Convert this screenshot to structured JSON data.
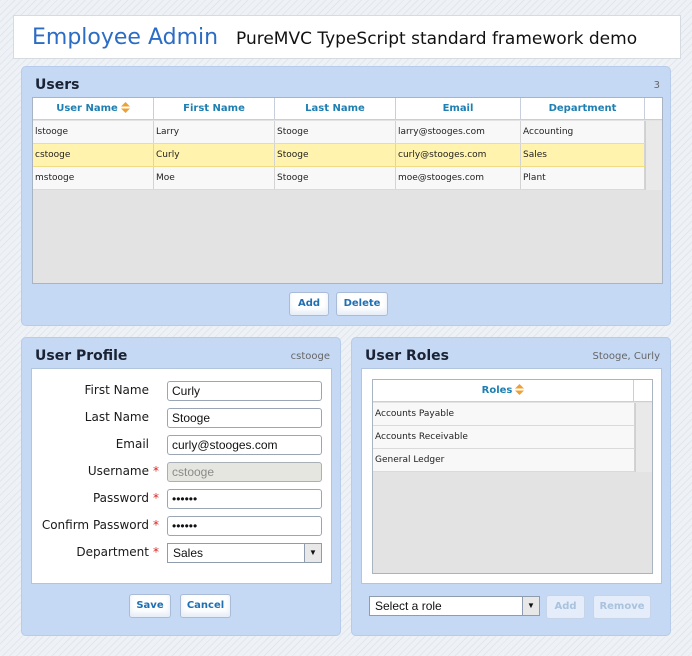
{
  "header": {
    "title": "Employee Admin",
    "subtitle": "PureMVC TypeScript standard framework demo"
  },
  "users_panel": {
    "title": "Users",
    "count": "3",
    "columns": [
      "User Name",
      "First Name",
      "Last Name",
      "Email",
      "Department"
    ],
    "rows": [
      {
        "username": "lstooge",
        "first": "Larry",
        "last": "Stooge",
        "email": "larry@stooges.com",
        "department": "Accounting"
      },
      {
        "username": "cstooge",
        "first": "Curly",
        "last": "Stooge",
        "email": "curly@stooges.com",
        "department": "Sales"
      },
      {
        "username": "mstooge",
        "first": "Moe",
        "last": "Stooge",
        "email": "moe@stooges.com",
        "department": "Plant"
      }
    ],
    "selected_row": 1,
    "add_label": "Add",
    "delete_label": "Delete"
  },
  "profile_panel": {
    "title": "User Profile",
    "status": "cstooge",
    "labels": {
      "first_name": "First Name",
      "last_name": "Last Name",
      "email": "Email",
      "username": "Username",
      "password": "Password",
      "confirm_password": "Confirm Password",
      "department": "Department"
    },
    "required_mark": "*",
    "values": {
      "first_name": "Curly",
      "last_name": "Stooge",
      "email": "curly@stooges.com",
      "username": "cstooge",
      "password": "••••••",
      "confirm_password": "••••••",
      "department": "Sales"
    },
    "save_label": "Save",
    "cancel_label": "Cancel"
  },
  "roles_panel": {
    "title": "User Roles",
    "status": "Stooge, Curly",
    "column": "Roles",
    "rows": [
      "Accounts Payable",
      "Accounts Receivable",
      "General Ledger"
    ],
    "role_select": "Select a role",
    "add_label": "Add",
    "remove_label": "Remove"
  },
  "colors": {
    "brand": "#2b6cc4",
    "panel_bg": "#c5d9f5",
    "header_text": "#1e7fb2",
    "selected_row": "#fff3ad",
    "sort_arrow": "#f0a030",
    "required": "#dd2222"
  },
  "icons": {
    "sort": "sort-arrows-icon",
    "dropdown": "chevron-down-icon"
  }
}
